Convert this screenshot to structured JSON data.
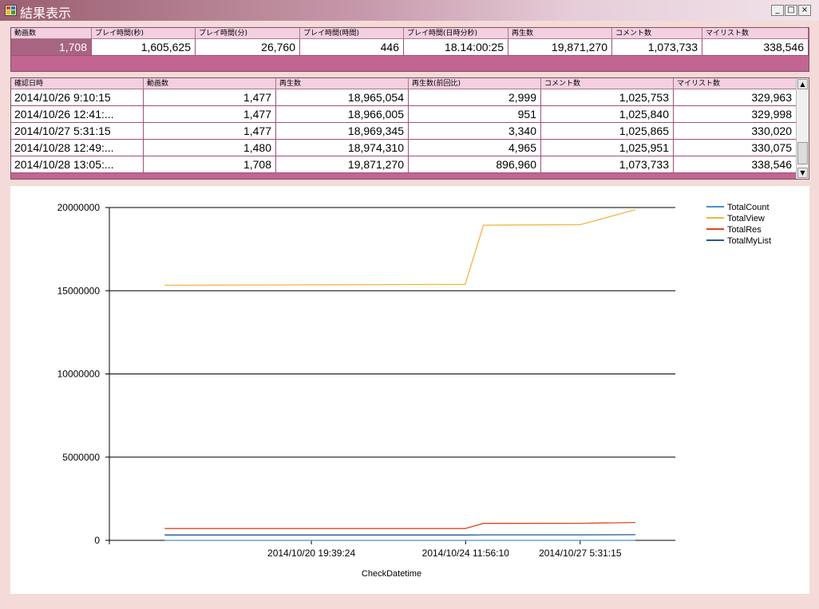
{
  "window": {
    "title": "結果表示",
    "controls": [
      "_",
      "□",
      "×"
    ]
  },
  "summary_table": {
    "headers": [
      "動画数",
      "プレイ時間(秒)",
      "プレイ時間(分)",
      "プレイ時間(時間)",
      "プレイ時間(日時分秒)",
      "再生数",
      "コメント数",
      "マイリスト数"
    ],
    "row": [
      "1,708",
      "1,605,625",
      "26,760",
      "446",
      "18.14:00:25",
      "19,871,270",
      "1,073,733",
      "338,546"
    ]
  },
  "history_table": {
    "headers": [
      "確認日時",
      "動画数",
      "再生数",
      "再生数(前回比)",
      "コメント数",
      "マイリスト数"
    ],
    "rows": [
      [
        "2014/10/26 9:10:15",
        "1,477",
        "18,965,054",
        "2,999",
        "1,025,753",
        "329,963"
      ],
      [
        "2014/10/26 12:41:...",
        "1,477",
        "18,966,005",
        "951",
        "1,025,840",
        "329,998"
      ],
      [
        "2014/10/27 5:31:15",
        "1,477",
        "18,969,345",
        "3,340",
        "1,025,865",
        "330,020"
      ],
      [
        "2014/10/28 12:49:...",
        "1,480",
        "18,974,310",
        "4,965",
        "1,025,951",
        "330,075"
      ],
      [
        "2014/10/28 13:05:...",
        "1,708",
        "19,871,270",
        "896,960",
        "1,073,733",
        "338,546"
      ]
    ]
  },
  "chart_data": {
    "type": "line",
    "xlabel": "CheckDatetime",
    "ylabel": "",
    "ylim": [
      0,
      20000000
    ],
    "yticks": [
      "0",
      "5000000",
      "10000000",
      "15000000",
      "20000000"
    ],
    "xticks": [
      "2014/10/20 19:39:24",
      "2014/10/24 11:56:10",
      "2014/10/27 5:31:15"
    ],
    "legend_position": "top-right",
    "grid": "horizontal",
    "x": [
      "2014/10/17 07:40",
      "2014/10/24 11:40",
      "2014/10/24 22:10",
      "2014/10/27 5:31:15",
      "2014/10/28 13:05"
    ],
    "series": [
      {
        "name": "TotalCount",
        "color": "#4a8fd0",
        "values": [
          1300,
          1400,
          1477,
          1477,
          1708
        ]
      },
      {
        "name": "TotalView",
        "color": "#f5b342",
        "values": [
          15330000,
          15380000,
          18940000,
          18969345,
          19871270
        ]
      },
      {
        "name": "TotalRes",
        "color": "#e0481c",
        "values": [
          710000,
          710000,
          1020000,
          1025865,
          1073733
        ]
      },
      {
        "name": "TotalMyList",
        "color": "#1f5a94",
        "values": [
          320000,
          320000,
          329000,
          330020,
          338546
        ]
      }
    ]
  }
}
